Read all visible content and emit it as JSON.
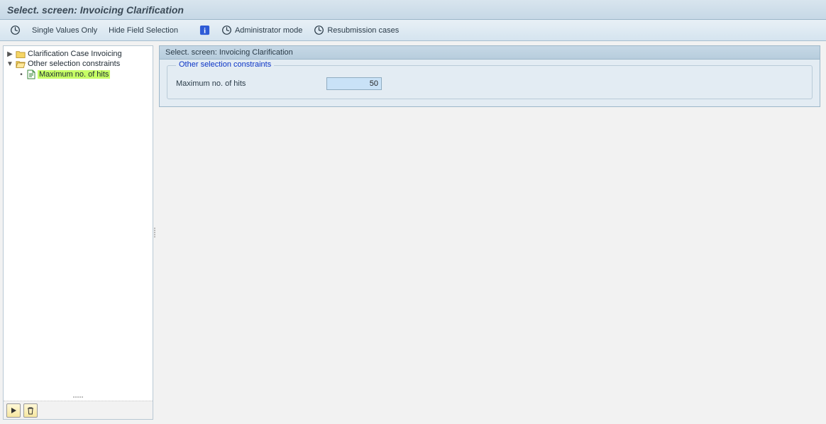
{
  "title": "Select. screen: Invoicing Clarification",
  "toolbar": {
    "single_values": "Single Values Only",
    "hide_field": "Hide Field Selection",
    "admin_mode": "Administrator mode",
    "resubmission": "Resubmission cases"
  },
  "tree": {
    "n1": {
      "label": "Clarification Case Invoicing",
      "expanded": false
    },
    "n2": {
      "label": "Other selection constraints",
      "expanded": true
    },
    "n2a": {
      "label": "Maximum no. of hits",
      "selected": true
    }
  },
  "panel": {
    "header": "Select. screen: Invoicing Clarification",
    "group_title": "Other selection constraints",
    "max_hits_label": "Maximum no. of hits",
    "max_hits_value": "50"
  }
}
